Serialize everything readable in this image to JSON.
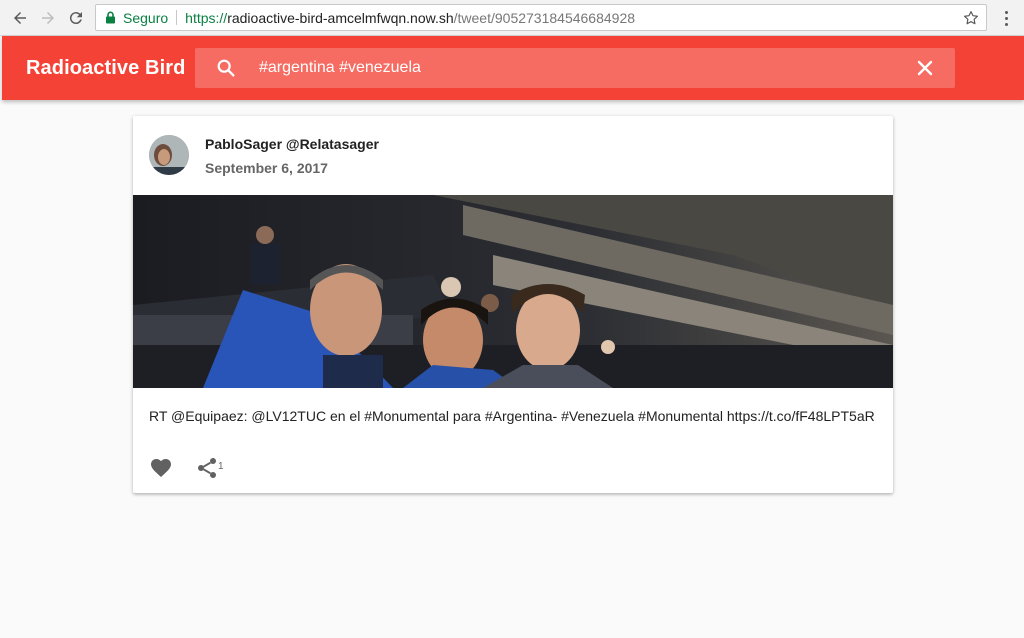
{
  "browser": {
    "secure_label": "Seguro",
    "url_scheme": "https://",
    "url_host": "radioactive-bird-amcelmfwqn.now.sh",
    "url_path": "/tweet/905273184546684928",
    "icons": [
      "back-arrow-icon",
      "forward-arrow-icon",
      "reload-icon",
      "lock-icon",
      "star-icon",
      "kebab-menu-icon"
    ]
  },
  "appbar": {
    "title": "Radioactive Bird",
    "search_value": "#argentina #venezuela",
    "color": "#f44336",
    "icons": [
      "search-icon",
      "close-icon"
    ]
  },
  "tweet": {
    "author": "PabloSager @Relatasager",
    "date": "September 6, 2017",
    "text": "RT @Equipaez: @LV12TUC en el #Monumental para #Argentina- #Venezuela #Monumental https://t.co/fF48LPT5aR",
    "share_count": "1",
    "icons": [
      "heart-icon",
      "share-icon"
    ]
  }
}
